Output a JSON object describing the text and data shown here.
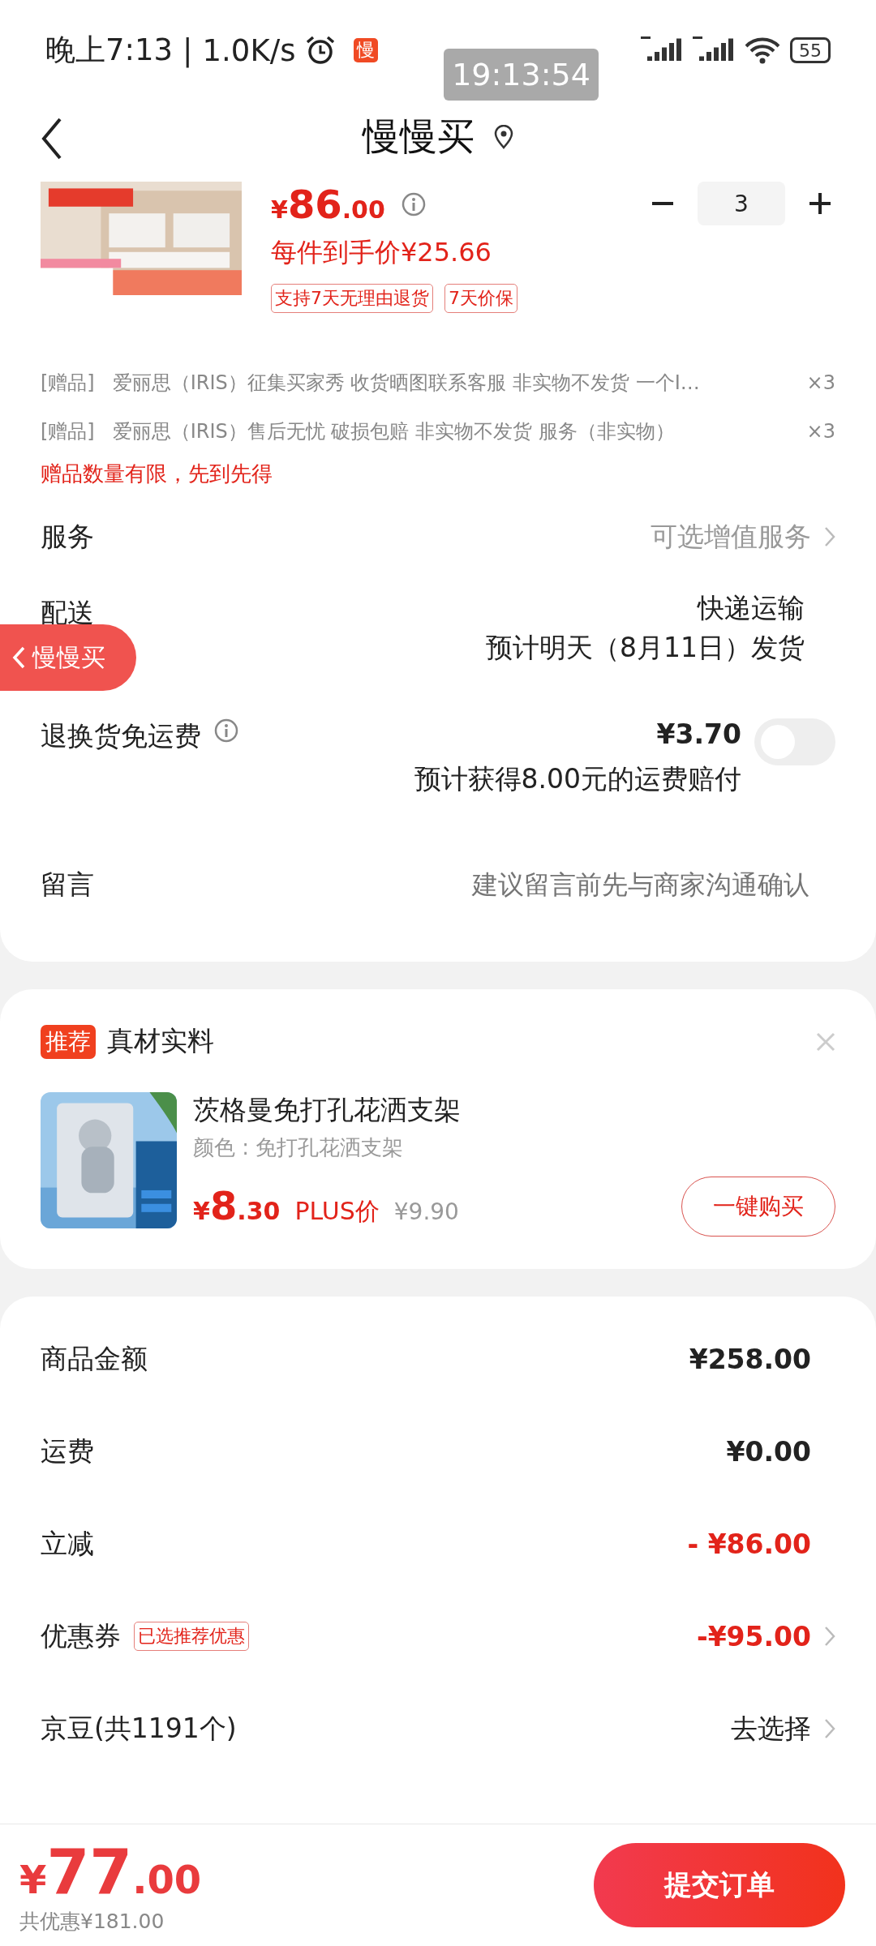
{
  "status_bar": {
    "time": "晚上7:13",
    "separator": "|",
    "speed": "1.0K/s",
    "app_badge": "慢",
    "battery": "55"
  },
  "clock_overlay": "19:13:54",
  "header": {
    "title": "慢慢买"
  },
  "product": {
    "price_symbol": "¥",
    "price_int": "86",
    "price_dec": ".00",
    "unit_price": "每件到手价¥25.66",
    "quantity": "3",
    "tags": [
      "支持7天无理由退货",
      "7天价保"
    ]
  },
  "gifts": [
    {
      "label": "[赠品]",
      "name": "爱丽思（IRIS）征集买家秀  收货晒图联系客服 非实物不发货 一个I…",
      "count": "×3"
    },
    {
      "label": "[赠品]",
      "name": "爱丽思（IRIS）售后无忧 破损包赔 非实物不发货 服务（非实物）",
      "count": "×3"
    }
  ],
  "gift_notice": "赠品数量有限，先到先得",
  "service": {
    "label": "服务",
    "value": "可选增值服务"
  },
  "delivery": {
    "label": "配送",
    "method": "快递运输",
    "eta": "预计明天（8月11日）发货"
  },
  "floating_button": {
    "label": "慢慢买"
  },
  "return_shipping": {
    "label": "退换货免运费",
    "price": "¥3.70",
    "note": "预计获得8.00元的运费赔付",
    "on": false
  },
  "message": {
    "label": "留言",
    "placeholder": "建议留言前先与商家沟通确认"
  },
  "recommendation": {
    "badge": "推荐",
    "title": "真材实料",
    "product_name": "茨格曼免打孔花洒支架",
    "variant": "颜色 : 免打孔花洒支架",
    "price_symbol": "¥",
    "price_int": "8",
    "price_dec": ".30",
    "plus_label": "PLUS价",
    "original_price": "¥9.90",
    "buy_button": "一键购买"
  },
  "summary": [
    {
      "label": "商品金额",
      "value": "¥258.00",
      "discount": false,
      "chevron": false
    },
    {
      "label": "运费",
      "value": "¥0.00",
      "discount": false,
      "chevron": false
    },
    {
      "label": "立减",
      "value": "- ¥86.00",
      "discount": true,
      "chevron": false
    },
    {
      "label": "优惠券",
      "tag": "已选推荐优惠",
      "value": "-¥95.00",
      "discount": true,
      "chevron": true
    },
    {
      "label": "京豆(共1191个)",
      "value": "去选择",
      "discount": false,
      "chevron": true
    }
  ],
  "bottom_bar": {
    "price_symbol": "¥",
    "price_int": "77",
    "price_dec": ".00",
    "savings": "共优惠¥181.00",
    "submit": "提交订单"
  }
}
